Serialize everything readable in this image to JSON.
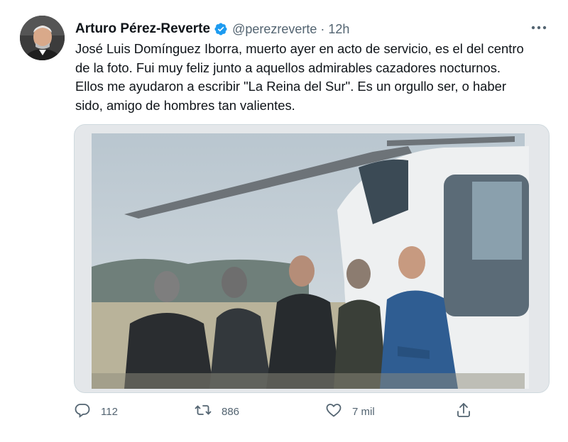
{
  "tweet": {
    "author_name": "Arturo Pérez-Reverte",
    "handle": "@perezreverte",
    "separator": "·",
    "time": "12h",
    "text_lines": [
      "José Luis Domínguez Iborra, muerto ayer en acto de servicio, es el del centro",
      "de la foto. Fui muy feliz junto a aquellos admirables cazadores nocturnos.",
      "Ellos me ayudaron a escribir \"La Reina del Sur\". Es un orgullo ser, o haber",
      "sido, amigo de hombres tan valientes."
    ]
  },
  "actions": {
    "replies": "112",
    "retweets": "886",
    "likes": "7 mil"
  },
  "colors": {
    "text": "#0f1419",
    "secondary": "#536471",
    "verified": "#1d9bf0",
    "border": "#cfd9de"
  },
  "icons": [
    "verified-badge-icon",
    "more-icon",
    "reply-icon",
    "retweet-icon",
    "like-icon",
    "share-icon"
  ]
}
